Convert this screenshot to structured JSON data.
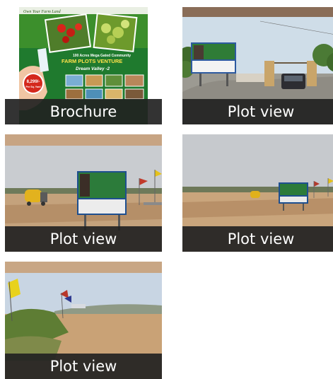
{
  "gallery": {
    "items": [
      {
        "caption": "Brochure",
        "image": {
          "script_line": "Own Your Farm Land",
          "headline_small": "100 Acres Mega Gated Community",
          "headline": "FARM PLOTS VENTURE",
          "project": "Dream Valley -2",
          "price": "8,299/-",
          "price_unit": "Per Sq. Yard"
        }
      },
      {
        "caption": "Plot view"
      },
      {
        "caption": "Plot view"
      },
      {
        "caption": "Plot view"
      },
      {
        "caption": "Plot view"
      }
    ]
  }
}
